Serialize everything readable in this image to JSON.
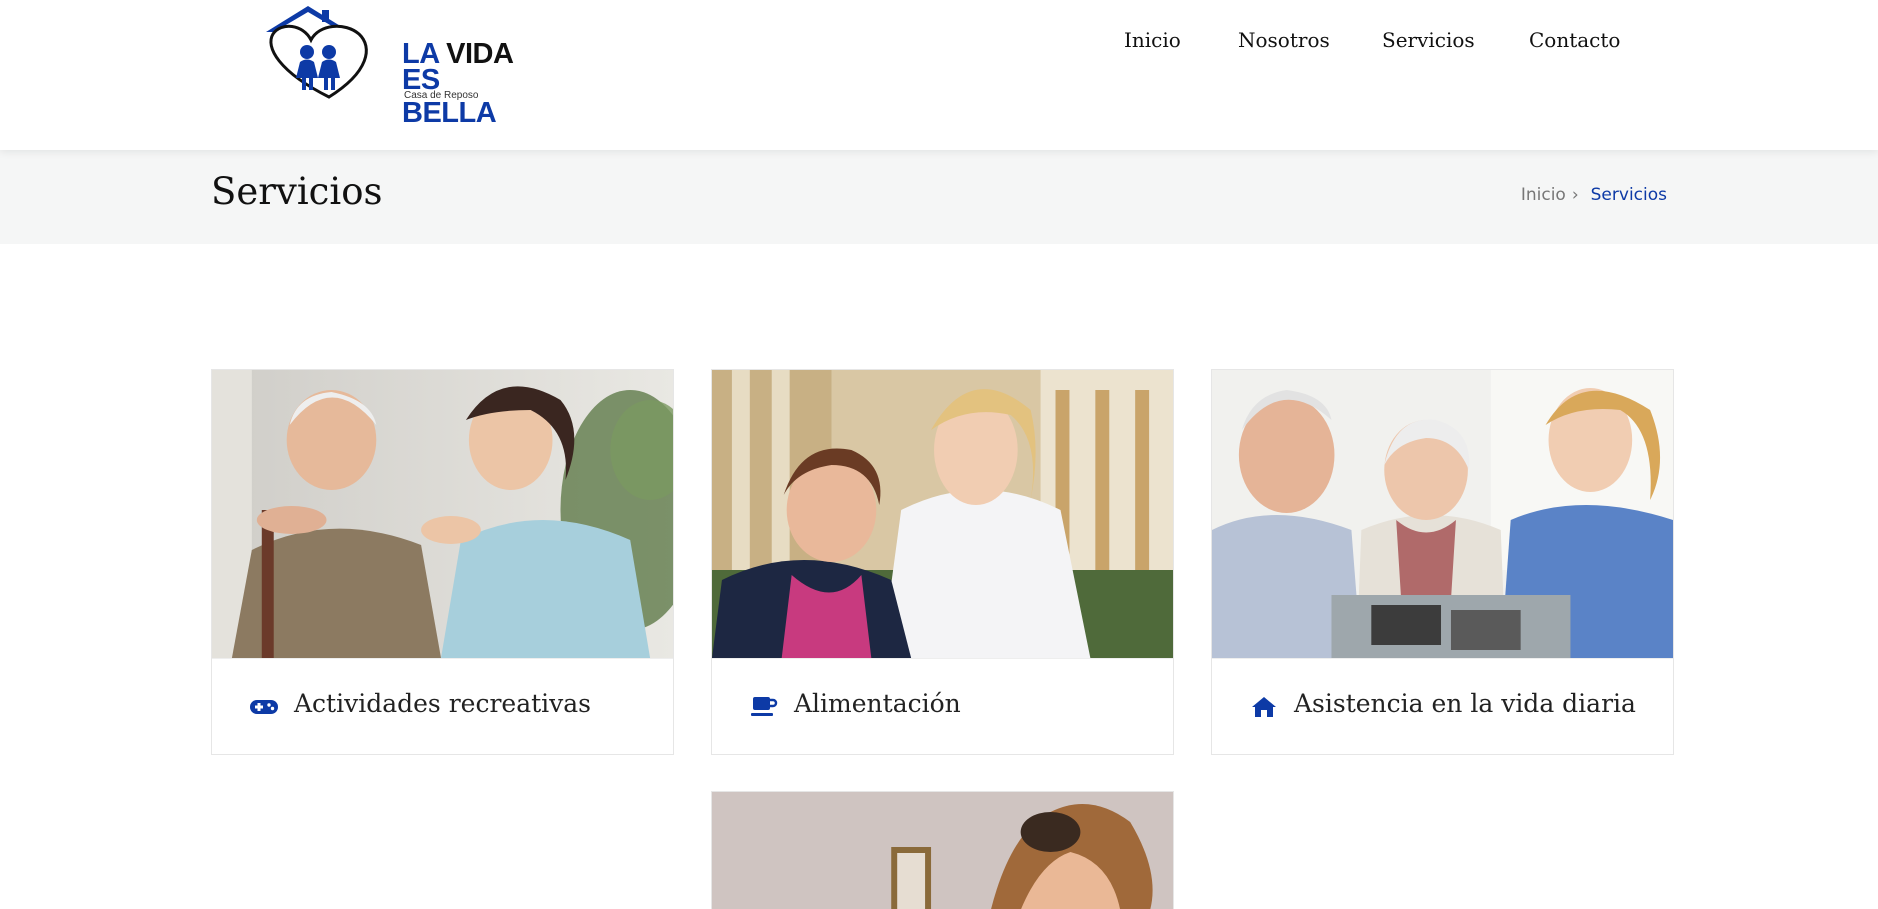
{
  "brand": {
    "line1_la": "LA",
    "line1_rest": " VIDA",
    "line2": "ES BELLA",
    "sub": "Casa de Reposo",
    "accent": "#0d3aa6"
  },
  "nav": {
    "items": [
      "Inicio",
      "Nosotros",
      "Servicios",
      "Contacto"
    ]
  },
  "page": {
    "title": "Servicios"
  },
  "breadcrumb": {
    "home": "Inicio",
    "separator": "›",
    "current": "Servicios"
  },
  "services": [
    {
      "label": "Actividades recreativas",
      "icon": "gamepad-icon"
    },
    {
      "label": "Alimentación",
      "icon": "coffee-cup-icon"
    },
    {
      "label": "Asistencia en la vida diaria",
      "icon": "home-icon"
    }
  ]
}
